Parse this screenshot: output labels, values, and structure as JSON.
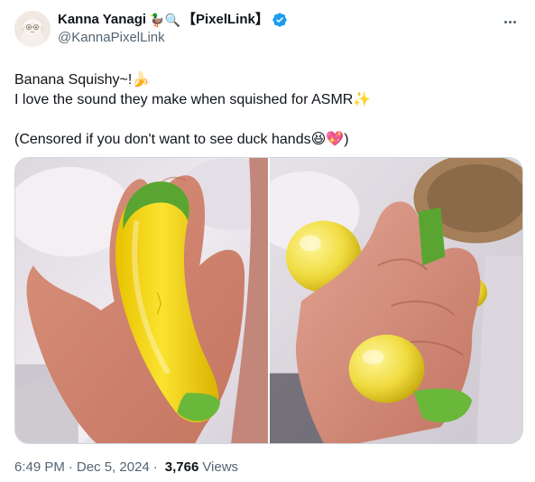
{
  "author": {
    "display_name": "Kanna Yanagi",
    "name_emojis": "🦆🔍",
    "affiliation": "【PixelLink】",
    "handle": "@KannaPixelLink"
  },
  "tweet": {
    "line1": "Banana Squishy~!",
    "line1_emoji": "🍌",
    "line2": "I love the sound they make when squished for ASMR",
    "line2_emoji": "✨",
    "line3": "",
    "line4_start": "(Censored if you don't want to see duck hands",
    "line4_emoji1": "😆",
    "line4_emoji2": "💖",
    "line4_end": ")"
  },
  "meta": {
    "time": "6:49 PM",
    "dot": "·",
    "date": "Dec 5, 2024",
    "views_count": "3,766",
    "views_label": "Views"
  },
  "colors": {
    "text": "#0f1419",
    "secondary": "#536471",
    "verified": "#1d9bf0",
    "border": "#cfd9de"
  }
}
